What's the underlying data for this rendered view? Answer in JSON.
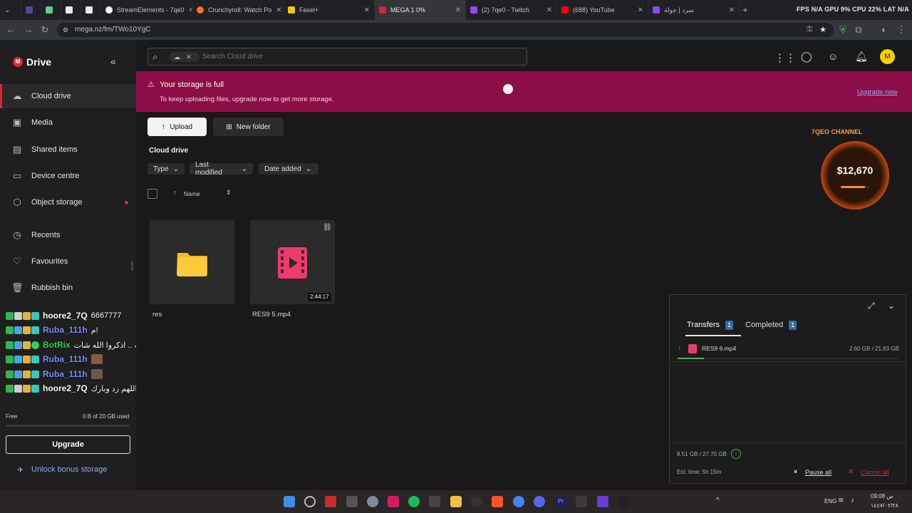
{
  "browser": {
    "tabs": [
      {
        "label": "StreamElements - 7qe0",
        "color": "#ffffff"
      },
      {
        "label": "Crunchyroll: Watch Po",
        "color": "#f47521"
      },
      {
        "label": "Fasel+",
        "color": "#f5c518"
      },
      {
        "label": "MEGA 1 0%",
        "color": "#d9272e",
        "active": true
      },
      {
        "label": "(2) 7qe0 - Twitch",
        "color": "#9146ff"
      },
      {
        "label": "(688) YouTube",
        "color": "#ff0000"
      },
      {
        "label": "سرد | جولة",
        "color": "#9146ff"
      }
    ],
    "stats": "FPS N/A  GPU 9%  CPU 22%  LAT N/A",
    "url": "mega.nz/fm/TWo10YgC"
  },
  "sidebar": {
    "brand": "Drive",
    "logo_letter": "M",
    "items": [
      {
        "label": "Cloud drive",
        "icon": "cloud-icon"
      },
      {
        "label": "Media",
        "icon": "image-icon"
      },
      {
        "label": "Shared items",
        "icon": "shared-folder-icon"
      },
      {
        "label": "Device centre",
        "icon": "monitor-icon"
      },
      {
        "label": "Object storage",
        "icon": "object-storage-icon"
      },
      {
        "label": "Recents",
        "icon": "clock-icon"
      },
      {
        "label": "Favourites",
        "icon": "heart-icon"
      },
      {
        "label": "Rubbish bin",
        "icon": "trash-icon"
      }
    ],
    "plan": "Free",
    "usage": "0 B of 20 GB used",
    "upgrade": "Upgrade",
    "bonus": "Unlock bonus storage"
  },
  "chat": [
    {
      "user": "hoore2_7Q",
      "message": "6667777",
      "color": "#ffffff"
    },
    {
      "user": "Ruba_111h",
      "message": "م!",
      "color": "#7b8cff"
    },
    {
      "user": "BotRix",
      "message": "ما شاء الله تبارك الله .. اذكروا الله شات 🤍",
      "color": "#35d05a"
    },
    {
      "user": "Ruba_111h",
      "message": "",
      "color": "#7b8cff"
    },
    {
      "user": "Ruba_111h",
      "message": "",
      "color": "#7b8cff"
    },
    {
      "user": "hoore2_7Q",
      "message": "ماشاءالله اللهم زد وبارك",
      "color": "#ffffff"
    }
  ],
  "main": {
    "search_placeholder": "Search Cloud drive",
    "banner_title": "Your storage is full",
    "banner_text": "To keep uploading files, upgrade now to get more storage.",
    "banner_link": "Upgrade now",
    "upload": "Upload",
    "new_folder": "New folder",
    "breadcrumb": "Cloud drive",
    "filters": [
      "Type",
      "Last modified",
      "Date added"
    ],
    "column_name": "Name",
    "files": [
      {
        "name": "res",
        "kind": "folder"
      },
      {
        "name": "RES9 5.mp4",
        "kind": "video",
        "duration": "2:44:17"
      }
    ]
  },
  "overlay": {
    "channel": "7QEO CHANNEL",
    "amount": "$12,670",
    "goal_progress": 0.85
  },
  "transfers": {
    "tab_transfers": "Transfers",
    "transfers_count": "1",
    "tab_completed": "Completed",
    "completed_count": "1",
    "item_name": "RES9 6.mp4",
    "item_size": "2.60 GB / 21.83 GB",
    "item_progress": 0.12,
    "total": "8.51 GB / 27.75 GB",
    "est": "Est. time: 5h 15m",
    "pause": "Pause all",
    "cancel": "Cancel all"
  },
  "taskbar": {
    "lang": "ENG",
    "time": "09:08 ص",
    "date": "١٤٤٧/٠٢/٢٨"
  }
}
